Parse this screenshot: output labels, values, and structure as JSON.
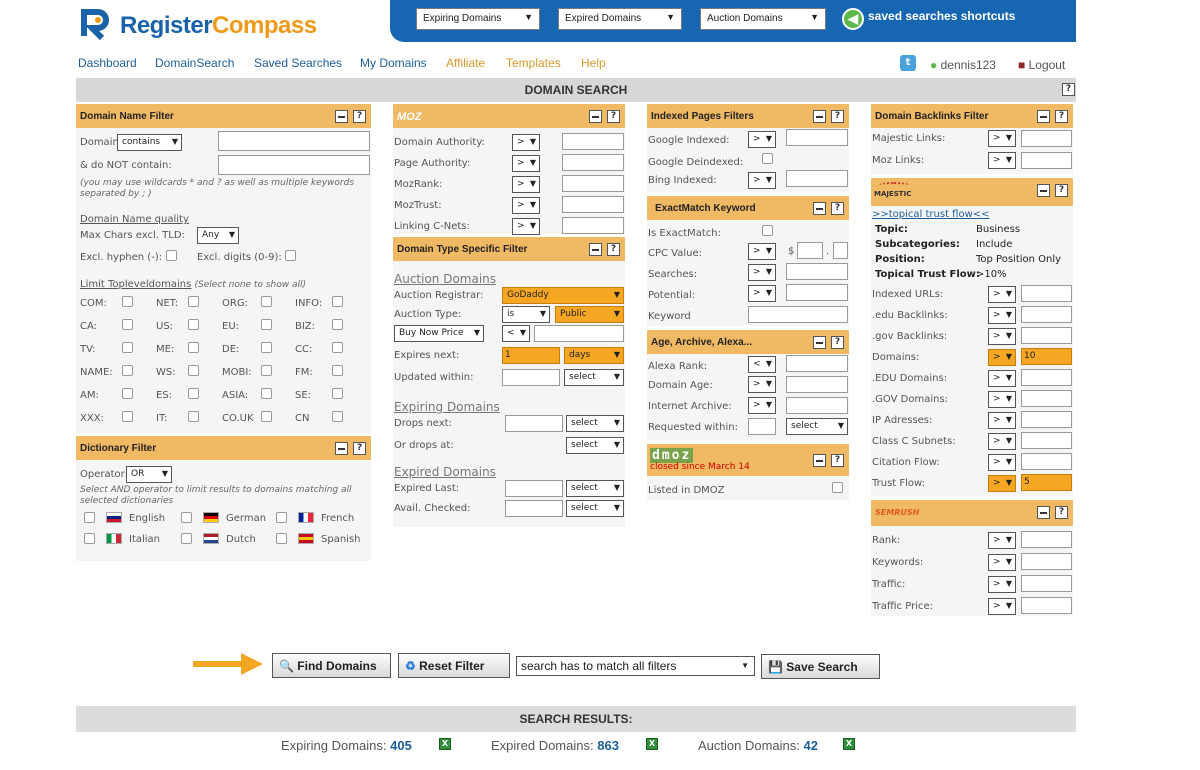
{
  "brand": {
    "name_a": "Register",
    "name_b": "Compass"
  },
  "topbar": {
    "sel1": "Expiring Domains",
    "sel2": "Expired Domains",
    "sel3": "Auction Domains",
    "saved": "saved searches shortcuts"
  },
  "nav": [
    "Dashboard",
    "DomainSearch",
    "Saved Searches",
    "My Domains",
    "Affiliate",
    "Templates",
    "Help"
  ],
  "user": {
    "name": "dennis123",
    "logout": "Logout"
  },
  "section_title": "DOMAIN SEARCH",
  "dn": {
    "title": "Domain Name Filter",
    "domain": "Domain",
    "contains": "contains",
    "notcontain": "& do NOT contain:",
    "note": "(you may use wildcards * and ? as well as multiple keywords separated by ; )",
    "quality": "Domain Name quality",
    "maxchars": "Max Chars excl. TLD:",
    "any": "Any",
    "hyphen": "Excl. hyphen (-):",
    "digits": "Excl. digits (0-9):",
    "limit": "Limit Topleveldomains",
    "limit_note": "(Select none to show all)",
    "tlds": [
      "COM:",
      "NET:",
      "ORG:",
      "INFO:",
      "CA:",
      "US:",
      "EU:",
      "BIZ:",
      "TV:",
      "ME:",
      "DE:",
      "CC:",
      "NAME:",
      "WS:",
      "MOBI:",
      "FM:",
      "AM:",
      "ES:",
      "ASIA:",
      "SE:",
      "XXX:",
      "IT:",
      "CO.UK",
      "CN"
    ]
  },
  "dict": {
    "title": "Dictionary Filter",
    "operator": "Operator:",
    "or": "OR",
    "note": "Select AND operator to limit results to domains matching all selected dictionaries",
    "langs": [
      "English",
      "German",
      "French",
      "Italian",
      "Dutch",
      "Spanish"
    ]
  },
  "moz": {
    "logo": "MOZ",
    "rows": [
      "Domain Authority:",
      "Page Authority:",
      "MozRank:",
      "MozTrust:",
      "Linking C-Nets:"
    ],
    "op": ">"
  },
  "dt": {
    "title": "Domain Type Specific Filter",
    "auction": "Auction Domains",
    "registrar": "Auction Registrar:",
    "godaddy": "GoDaddy",
    "type": "Auction Type:",
    "is": "is",
    "public": "Public",
    "buynow": "Buy Now Price",
    "lt": "<",
    "expnext": "Expires next:",
    "expval": "1",
    "days": "days",
    "updated": "Updated within:",
    "select": "select",
    "expiring": "Expiring Domains",
    "drops": "Drops next:",
    "orat": "Or drops at:",
    "expired": "Expired Domains",
    "explast": "Expired Last:",
    "avail": "Avail. Checked:"
  },
  "idx": {
    "title": "Indexed Pages Filters",
    "rows": [
      "Google Indexed:",
      "Google Deindexed:",
      "Bing Indexed:"
    ]
  },
  "em": {
    "title": "ExactMatch Keyword",
    "rows": [
      "Is ExactMatch:",
      "CPC Value:",
      "Searches:",
      "Potential:",
      "Keyword"
    ],
    "dollar": "$",
    "dot": "."
  },
  "age": {
    "title": "Age, Archive, Alexa...",
    "rows": [
      "Alexa Rank:",
      "Domain Age:",
      "Internet Archive:",
      "Requested within:"
    ],
    "lt": "<"
  },
  "dmoz": {
    "logo": "dmoz",
    "closed": "closed since March 14",
    "listed": "Listed in DMOZ"
  },
  "bl": {
    "title": "Domain Backlinks Filter",
    "rows": [
      "Majestic Links:",
      "Moz Links:"
    ]
  },
  "maj": {
    "logo": "MAJESTIC",
    "link": ">>topical trust flow<<",
    "topic_k": "Topic:",
    "topic_v": "Business",
    "sub_k": "Subcategories:",
    "sub_v": "Include",
    "pos_k": "Position:",
    "pos_v": "Top Position Only",
    "ttf_k": "Topical Trust Flow:",
    "ttf_v": ">10%",
    "rows": [
      "Indexed URLs:",
      ".edu Backlinks:",
      ".gov Backlinks:",
      "Domains:",
      ".EDU Domains:",
      ".GOV Domains:",
      "IP Adresses:",
      "Class C Subnets:",
      "Citation Flow:",
      "Trust Flow:"
    ],
    "domains_val": "10",
    "tf_val": "5"
  },
  "sem": {
    "logo": "SEMRUSH",
    "rows": [
      "Rank:",
      "Keywords:",
      "Traffic:",
      "Traffic Price:"
    ]
  },
  "actions": {
    "find": "Find Domains",
    "reset": "Reset Filter",
    "match": "search has to match all filters",
    "save": "Save Search"
  },
  "results": {
    "title": "SEARCH RESULTS:",
    "exp_label": "Expiring Domains:",
    "exp_n": "405",
    "expd_label": "Expired Domains:",
    "expd_n": "863",
    "auc_label": "Auction Domains:",
    "auc_n": "42"
  }
}
